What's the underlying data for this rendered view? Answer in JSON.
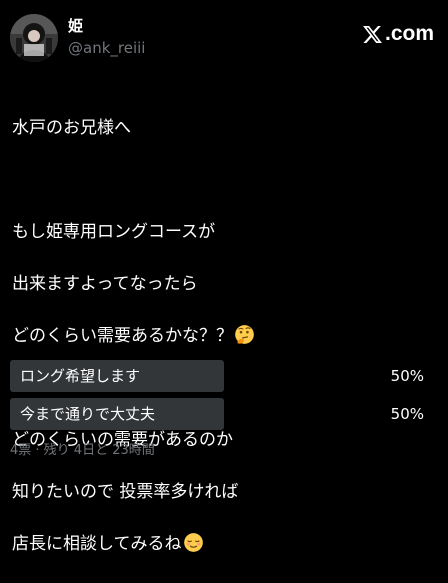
{
  "author": {
    "display_name": "姫",
    "handle": "@ank_reiii"
  },
  "site": {
    "domain": ".com",
    "logo_icon": "x-logo-icon"
  },
  "tweet": {
    "lines": [
      "水戸のお兄様へ",
      "",
      "もし姫専用ロングコースが",
      "出来ますよってなったら",
      "どのくらい需要あるかな？？",
      "",
      "どのくらいの需要があるのか",
      "知りたいので 投票率多ければ",
      "店長に相談してみるね"
    ],
    "emojis": {
      "line_4": "thinking-face-emoji",
      "line_8": "relieved-face-emoji"
    }
  },
  "poll": {
    "options": [
      {
        "label": "ロング希望します",
        "percent_text": "50%",
        "percent": 50
      },
      {
        "label": "今まで通りで大丈夫",
        "percent_text": "50%",
        "percent": 50
      }
    ],
    "meta": "4票 · 残り 4日と 23時間"
  },
  "colors": {
    "background": "#000000",
    "poll_fill": "#333639",
    "muted_text": "#71767b"
  }
}
